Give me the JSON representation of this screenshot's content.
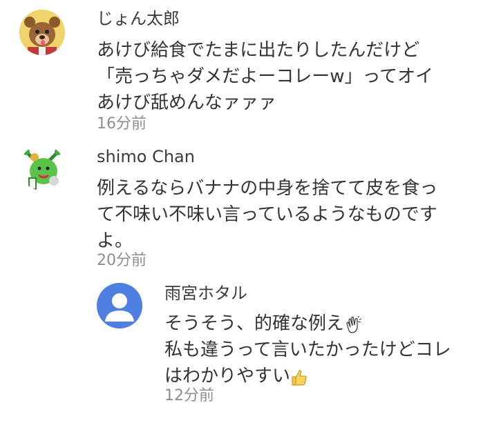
{
  "comments": [
    {
      "author": "じょん太郎",
      "lines": [
        "あけび給食でたまに出たりしたんだけど",
        "「売っちゃダメだよーコレーw」ってオイ",
        "あけび舐めんなァァァ"
      ],
      "time": "16分前",
      "avatar_icon": "bear-mascot-avatar-icon"
    },
    {
      "author": "shimo Chan",
      "lines": [
        "例えるならバナナの中身を捨てて皮を食っ",
        "て不味い不味い言っているようなものです",
        "よ。"
      ],
      "time": "20分前",
      "avatar_icon": "green-mascot-avatar-icon"
    }
  ],
  "reply": {
    "author": "雨宮ホタル",
    "lines": [
      "そうそう、的確な例え",
      "私も違うって言いたかったけどコレ",
      "はわかりやすい"
    ],
    "line1_emoji": "clapping-hands-icon",
    "line3_emoji": "thumbs-up-icon",
    "time": "12分前",
    "avatar_icon": "default-user-avatar-icon",
    "avatar_color": "#4f7fe0"
  }
}
